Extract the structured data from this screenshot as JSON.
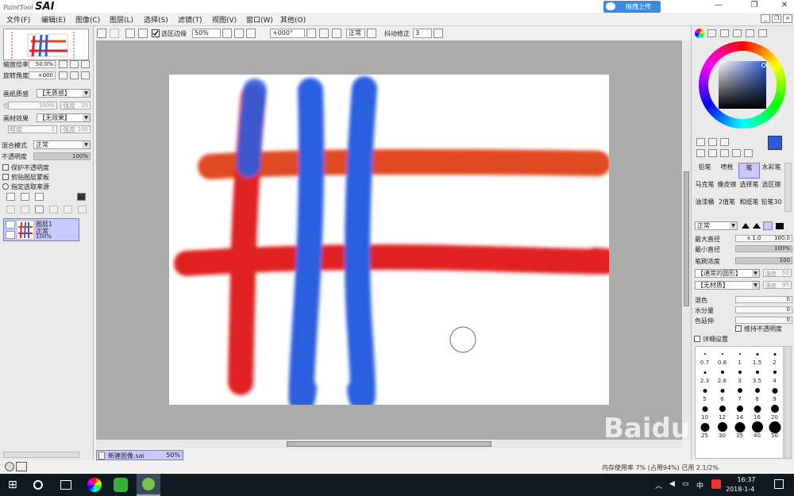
{
  "app": {
    "logo_small": "PaintTool",
    "logo_big": "SAI",
    "upload_label": "拖拽上传"
  },
  "menu": [
    "文件(F)",
    "编辑(E)",
    "图像(C)",
    "图层(L)",
    "选择(S)",
    "滤镜(T)",
    "视图(V)",
    "窗口(W)",
    "其他(O)"
  ],
  "nav": {
    "zoom_label": "缩放倍率",
    "zoom_value": "50.0%",
    "rotate_label": "旋转角度",
    "rotate_value": "+000"
  },
  "layer_props": {
    "paper_texture_label": "画纸质感",
    "paper_texture_value": "【无质感】",
    "scale_label": "倍率",
    "scale_value": "100%",
    "strength_label": "强度",
    "strength_value": "20",
    "material_label": "画材效果",
    "material_value": "【无效果】",
    "degree_label": "程度",
    "degree_value": "1",
    "strength2_label": "强度",
    "strength2_value": "100",
    "blend_label": "混合模式",
    "blend_value": "正常",
    "opacity_label": "不透明度",
    "opacity_value": "100%",
    "protect_opacity": "保护不透明度",
    "clip_mask": "剪贴图层蒙板",
    "select_source": "指定选取来源"
  },
  "layer": {
    "name": "图层1",
    "mode": "正常",
    "opacity": "100%"
  },
  "toolbar": {
    "selection_edge": "选区边缘",
    "zoom": "50%",
    "angle": "+000°",
    "mode": "正常",
    "stabilizer_label": "抖动修正",
    "stabilizer_value": "3"
  },
  "document_tab": {
    "name": "新建图像.sai",
    "zoom": "50%"
  },
  "status": {
    "memory": "内存使用率 7% (占用94%)  已用 2.1/2%"
  },
  "brushes": [
    [
      "铅笔",
      "喷枪",
      "笔",
      "水彩笔"
    ],
    [
      "马克笔",
      "橡皮擦",
      "选择笔",
      "选区擦"
    ],
    [
      "油漆桶",
      "2值笔",
      "和纸笔",
      "铅笔30"
    ]
  ],
  "brush_settings": {
    "mode": "正常",
    "max_size_label": "最大直径",
    "max_size_mult": "x 1.0",
    "max_size_value": "100.0",
    "min_size_label": "最小直径",
    "min_size_value": "100%",
    "density_label": "笔刷浓度",
    "density_value": "100",
    "shape": "【通常的圆形】",
    "shape_strength_label": "强度",
    "shape_strength": "50",
    "texture": "【无材质】",
    "texture_strength_label": "强度",
    "texture_strength": "95",
    "blend_label": "混色",
    "blend_value": "0",
    "water_label": "水分量",
    "water_value": "0",
    "extend_label": "色延伸",
    "extend_value": "0",
    "keep_opacity": "维持不透明度",
    "detail": "详细设置"
  },
  "brush_sizes": [
    "0.7",
    "0.8",
    "1",
    "1.5",
    "2",
    "2.3",
    "2.6",
    "3",
    "3.5",
    "4",
    "5",
    "6",
    "7",
    "8",
    "9",
    "10",
    "12",
    "14",
    "16",
    "20",
    "25",
    "30",
    "35",
    "40",
    "50"
  ],
  "taskbar": {
    "time": "16:37",
    "date": "2018-1-4",
    "ime": "中"
  },
  "watermark": "Baidu",
  "colors": {
    "accent": "#3b8be0",
    "primary_color": "#2f5bd8",
    "stroke_blue": "#2c5fe0",
    "stroke_red": "#e02020",
    "stroke_orange": "#e04a20"
  }
}
